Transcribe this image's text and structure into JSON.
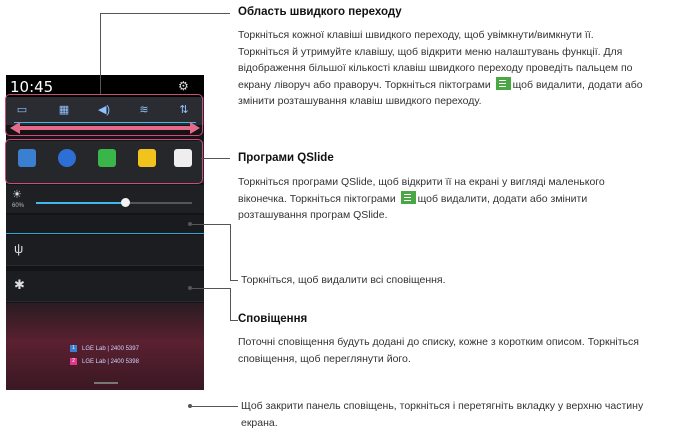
{
  "phone": {
    "time": "10:45",
    "brightness_percent_label": "60%",
    "brightness_level": 0.57,
    "notifications": [
      {
        "icon": "usb-icon"
      },
      {
        "icon": "android-debug-icon"
      }
    ],
    "wallpaper_lines": [
      "LGE Lab | 2400 5397",
      "LGE Lab | 2400 5398"
    ],
    "wallpaper_badges": [
      "1",
      "2"
    ]
  },
  "sections": {
    "quick_settings": {
      "title": "Область швидкого переходу",
      "lines": [
        "Торкніться кожної клавіші швидкого переходу, щоб увімкнути/вимкнути її.",
        "Торкніться й утримуйте клавішу, щоб відкрити меню налаштувань функції. Для",
        "відображення більшої кількості клавіш швидкого переходу проведіть пальцем по",
        "екрану ліворуч або праворуч. Торкніться піктограми",
        "щоб видалити, додати або",
        "змінити розташування клавіш швидкого переходу."
      ]
    },
    "qslide": {
      "title": "Програми QSlide",
      "lines": [
        "Торкніться програми QSlide, щоб відкрити її на екрані у вигляді маленького",
        "віконечка. Торкніться піктограми",
        "щоб видалити, додати або змінити",
        "розташування програм QSlide."
      ]
    },
    "clear": {
      "text": "Торкніться, щоб видалити всі сповіщення."
    },
    "notifications": {
      "title": "Сповіщення",
      "lines": [
        "Поточні сповіщення будуть додані до списку, кожне з коротким описом. Торкніться",
        "сповіщення, щоб переглянути його."
      ]
    },
    "close_panel": {
      "lines": [
        "Щоб закрити панель сповіщень, торкніться і перетягніть вкладку у верхню частину",
        "екрана."
      ]
    }
  },
  "colors": {
    "highlight": "#d04a7a",
    "accent_blue": "#3fb9f0",
    "edit_icon_green": "#4aa844"
  }
}
